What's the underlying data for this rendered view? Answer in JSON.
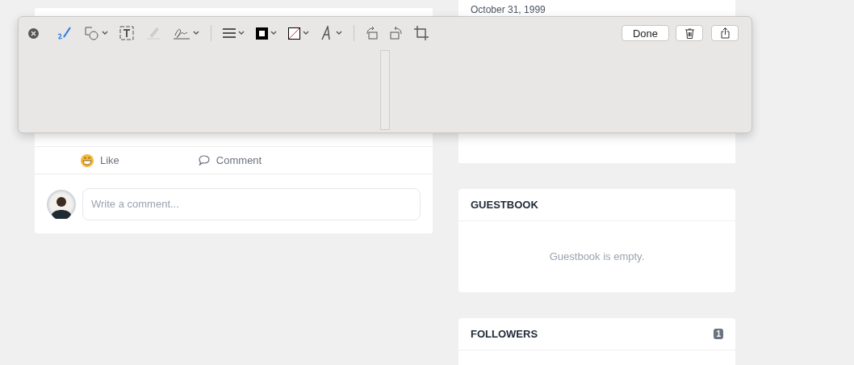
{
  "post": {
    "actions": [
      {
        "kind": "like",
        "label": "Like"
      },
      {
        "kind": "comment",
        "label": "Comment"
      }
    ],
    "comment_field": {
      "placeholder": "Write a comment..."
    }
  },
  "profile": {
    "date": "October 31, 1999"
  },
  "guestbook": {
    "title": "GUESTBOOK",
    "empty_text": "Guestbook is empty."
  },
  "followers": {
    "title": "FOLLOWERS",
    "count": "1"
  },
  "markup_toolbar": {
    "tools": [
      {
        "kind": "sketch",
        "selected": true,
        "disabled": false
      },
      {
        "kind": "shapes",
        "selected": false,
        "disabled": false
      },
      {
        "kind": "text",
        "selected": false,
        "disabled": false
      },
      {
        "kind": "highlight",
        "selected": false,
        "disabled": true
      },
      {
        "kind": "sign",
        "selected": false,
        "disabled": false
      },
      {
        "kind": "line",
        "selected": false,
        "disabled": false
      },
      {
        "kind": "border",
        "selected": false,
        "disabled": false
      },
      {
        "kind": "fill",
        "selected": false,
        "disabled": false
      },
      {
        "kind": "font",
        "selected": false,
        "disabled": false
      },
      {
        "kind": "rotate-right",
        "selected": false,
        "disabled": false
      },
      {
        "kind": "rotate-left",
        "selected": false,
        "disabled": false
      },
      {
        "kind": "crop",
        "selected": false,
        "disabled": false
      }
    ],
    "done_label": "Done"
  }
}
